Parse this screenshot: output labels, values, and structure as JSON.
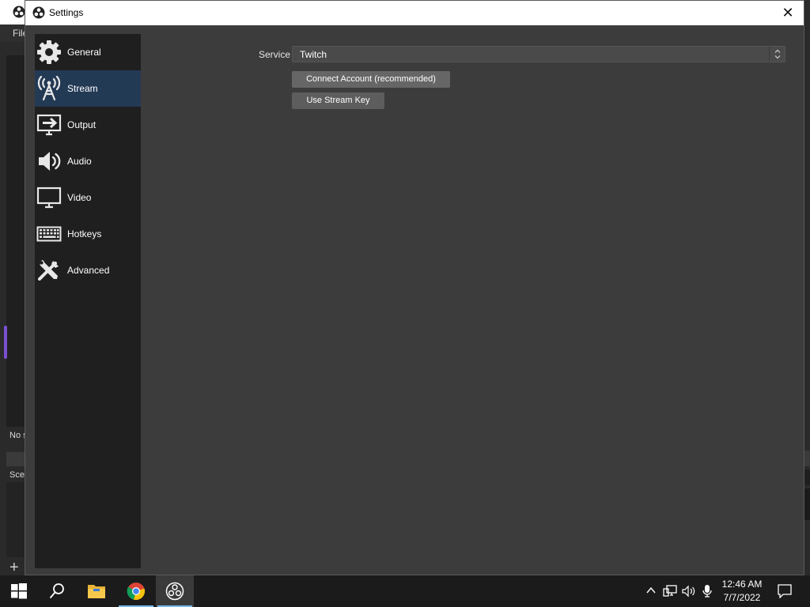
{
  "background": {
    "menu_file": "File",
    "no_source_text": "No s",
    "scenes_label": "Scen",
    "add_symbol": "+",
    "accent_color": "#7b4fd0"
  },
  "dialog": {
    "title": "Settings",
    "close_symbol": "✕"
  },
  "sidebar": {
    "selected_bg": "#233a55",
    "items": [
      {
        "label": "General",
        "icon": "gear-icon"
      },
      {
        "label": "Stream",
        "icon": "antenna-icon",
        "selected": true
      },
      {
        "label": "Output",
        "icon": "output-icon"
      },
      {
        "label": "Audio",
        "icon": "speaker-icon"
      },
      {
        "label": "Video",
        "icon": "monitor-icon"
      },
      {
        "label": "Hotkeys",
        "icon": "keyboard-icon"
      },
      {
        "label": "Advanced",
        "icon": "tools-icon"
      }
    ]
  },
  "stream": {
    "service_label": "Service",
    "service_value": "Twitch",
    "connect_account_label": "Connect Account (recommended)",
    "use_stream_key_label": "Use Stream Key"
  },
  "taskbar": {
    "time": "12:46 AM",
    "date": "7/7/2022",
    "accent_color": "#76b9ed"
  }
}
